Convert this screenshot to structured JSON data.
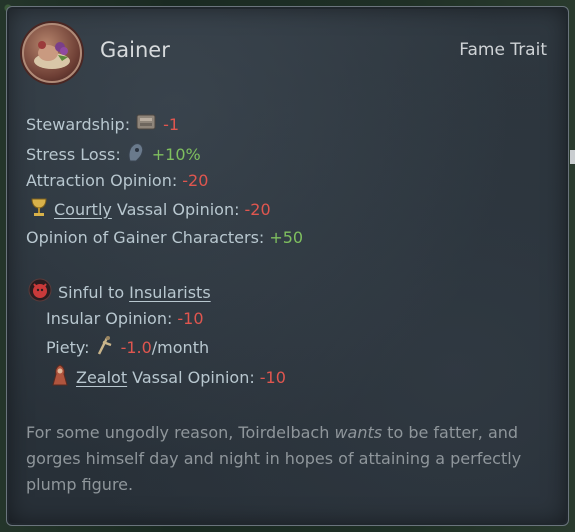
{
  "trait": {
    "name": "Gainer",
    "category": "Fame Trait"
  },
  "modifiers": {
    "stewardship": {
      "label": "Stewardship:",
      "value": "-1"
    },
    "stress_loss": {
      "label": "Stress Loss:",
      "value": "+10%"
    },
    "attraction": {
      "label": "Attraction Opinion:",
      "value": "-20"
    },
    "courtly": {
      "link": "Courtly",
      "label": "Vassal Opinion:",
      "value": "-20"
    },
    "same_trait": {
      "label": "Opinion of Gainer Characters:",
      "value": "+50"
    }
  },
  "sinful": {
    "prefix": "Sinful to",
    "faith": "Insularists",
    "insular_opinion": {
      "label": "Insular Opinion:",
      "value": "-10"
    },
    "piety": {
      "label": "Piety:",
      "value": "-1.0",
      "unit": "/month"
    },
    "zealot": {
      "link": "Zealot",
      "label": "Vassal Opinion:",
      "value": "-10"
    }
  },
  "flavor": {
    "part1": "For some ungodly reason, Toirdelbach ",
    "emphasis": "wants",
    "part2": " to be fatter, and gorges himself day and night in hopes of attaining a perfectly plump figure."
  },
  "colors": {
    "negative": "#e0564f",
    "positive": "#7fbf5f",
    "label": "#b8c7cf"
  },
  "icons": [
    "food-platter-icon",
    "stewardship-icon",
    "stress-icon",
    "chalice-icon",
    "sin-icon",
    "piety-icon",
    "zealot-icon"
  ]
}
